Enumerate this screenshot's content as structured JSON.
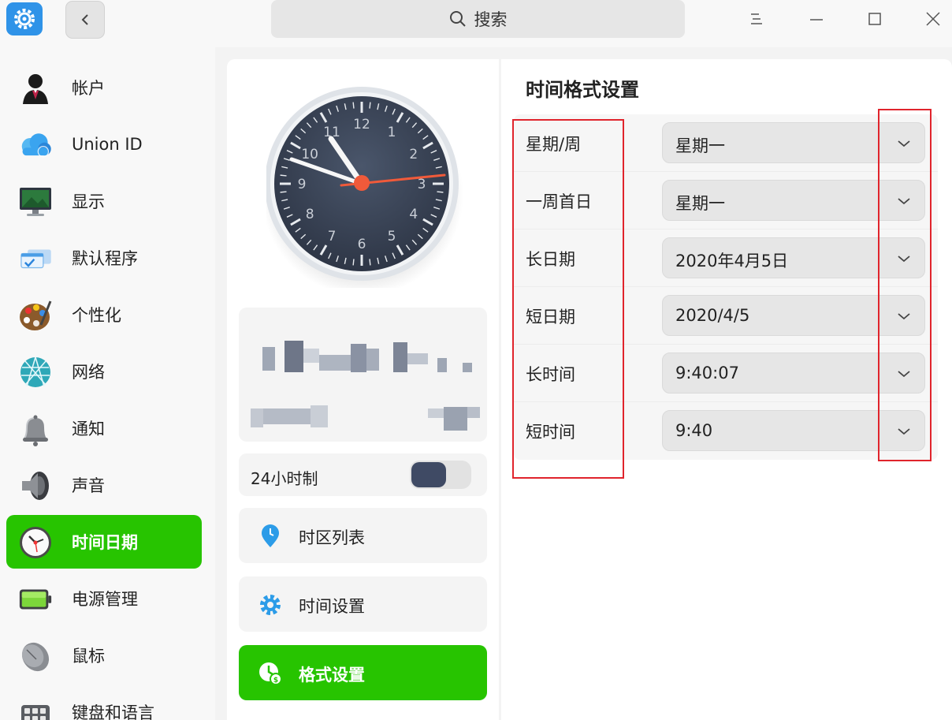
{
  "search": {
    "label": "搜索"
  },
  "sidebar": {
    "items": [
      {
        "label": "帐户",
        "icon": "account-icon"
      },
      {
        "label": "Union ID",
        "icon": "cloud-icon"
      },
      {
        "label": "显示",
        "icon": "monitor-icon"
      },
      {
        "label": "默认程序",
        "icon": "default-apps-icon"
      },
      {
        "label": "个性化",
        "icon": "palette-icon"
      },
      {
        "label": "网络",
        "icon": "network-globe-icon"
      },
      {
        "label": "通知",
        "icon": "bell-icon"
      },
      {
        "label": "声音",
        "icon": "speaker-icon"
      },
      {
        "label": "时间日期",
        "icon": "clock-icon",
        "active": true
      },
      {
        "label": "电源管理",
        "icon": "battery-icon"
      },
      {
        "label": "鼠标",
        "icon": "mouse-icon"
      },
      {
        "label": "键盘和语言",
        "icon": "keyboard-icon"
      }
    ]
  },
  "clock": {
    "numerals": [
      "12",
      "1",
      "2",
      "3",
      "4",
      "5",
      "6",
      "7",
      "8",
      "9",
      "10",
      "11"
    ]
  },
  "settings": {
    "hour24_label": "24小时制",
    "hour24_on": true,
    "menu": [
      {
        "label": "时区列表",
        "icon": "location-pin-icon"
      },
      {
        "label": "时间设置",
        "icon": "gear-icon"
      },
      {
        "label": "格式设置",
        "icon": "format-clock-icon",
        "active": true
      }
    ]
  },
  "format": {
    "title": "时间格式设置",
    "rows": [
      {
        "label": "星期/周",
        "value": "星期一"
      },
      {
        "label": "一周首日",
        "value": "星期一"
      },
      {
        "label": "长日期",
        "value": "2020年4月5日"
      },
      {
        "label": "短日期",
        "value": "2020/4/5"
      },
      {
        "label": "长时间",
        "value": "9:40:07"
      },
      {
        "label": "短时间",
        "value": "9:40"
      }
    ]
  },
  "colors": {
    "accent": "#27c400",
    "annotation": "#e0242c",
    "clock_face": "#3a4456",
    "second_hand": "#f05a3a"
  }
}
